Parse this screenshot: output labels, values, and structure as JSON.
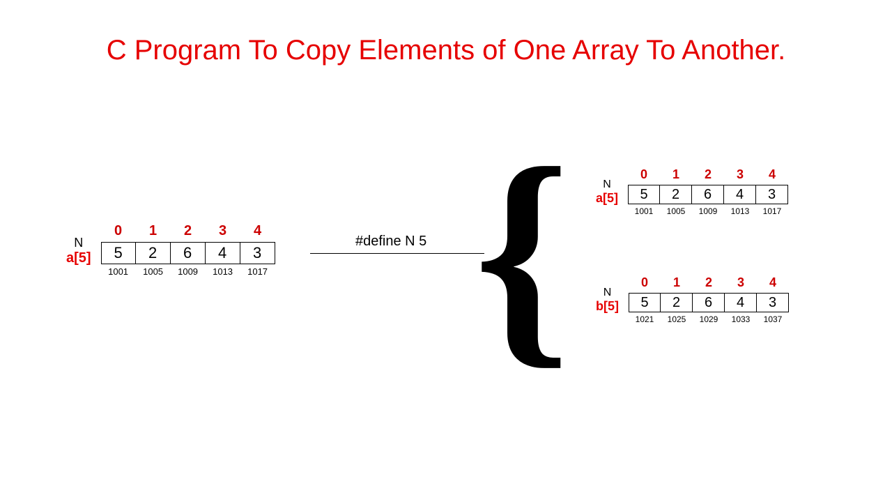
{
  "title": "C Program To Copy Elements of One Array To Another.",
  "define_text": "#define N 5",
  "indices": [
    "0",
    "1",
    "2",
    "3",
    "4"
  ],
  "left_array": {
    "nlabel": "N",
    "name": "a[5]",
    "values": [
      "5",
      "2",
      "6",
      "4",
      "3"
    ],
    "addrs": [
      "1001",
      "1005",
      "1009",
      "1013",
      "1017"
    ]
  },
  "right_a": {
    "nlabel": "N",
    "name": "a[5]",
    "values": [
      "5",
      "2",
      "6",
      "4",
      "3"
    ],
    "addrs": [
      "1001",
      "1005",
      "1009",
      "1013",
      "1017"
    ]
  },
  "right_b": {
    "nlabel": "N",
    "name": "b[5]",
    "values": [
      "5",
      "2",
      "6",
      "4",
      "3"
    ],
    "addrs": [
      "1021",
      "1025",
      "1029",
      "1033",
      "1037"
    ]
  },
  "brace_char": "{"
}
